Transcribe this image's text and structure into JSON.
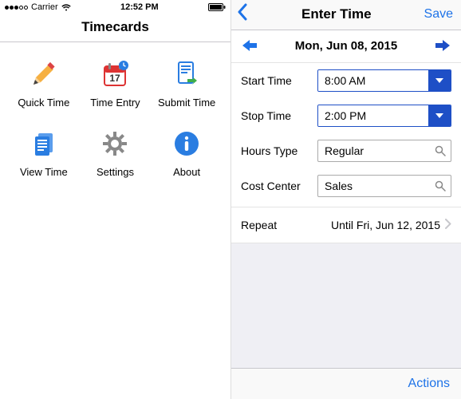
{
  "left": {
    "carrier": "Carrier",
    "time": "12:52 PM",
    "title": "Timecards",
    "grid": [
      {
        "name": "quick-time",
        "label": "Quick Time"
      },
      {
        "name": "time-entry",
        "label": "Time Entry"
      },
      {
        "name": "submit-time",
        "label": "Submit Time"
      },
      {
        "name": "view-time",
        "label": "View Time"
      },
      {
        "name": "settings",
        "label": "Settings"
      },
      {
        "name": "about",
        "label": "About"
      }
    ]
  },
  "right": {
    "nav": {
      "title": "Enter Time",
      "save": "Save"
    },
    "date": "Mon, Jun 08, 2015",
    "fields": {
      "start_time": {
        "label": "Start Time",
        "value": "8:00 AM"
      },
      "stop_time": {
        "label": "Stop Time",
        "value": "2:00 PM"
      },
      "hours_type": {
        "label": "Hours Type",
        "value": "Regular"
      },
      "cost_center": {
        "label": "Cost Center",
        "value": "Sales"
      }
    },
    "repeat": {
      "label": "Repeat",
      "value": "Until Fri, Jun 12, 2015"
    },
    "toolbar": {
      "actions": "Actions"
    }
  }
}
